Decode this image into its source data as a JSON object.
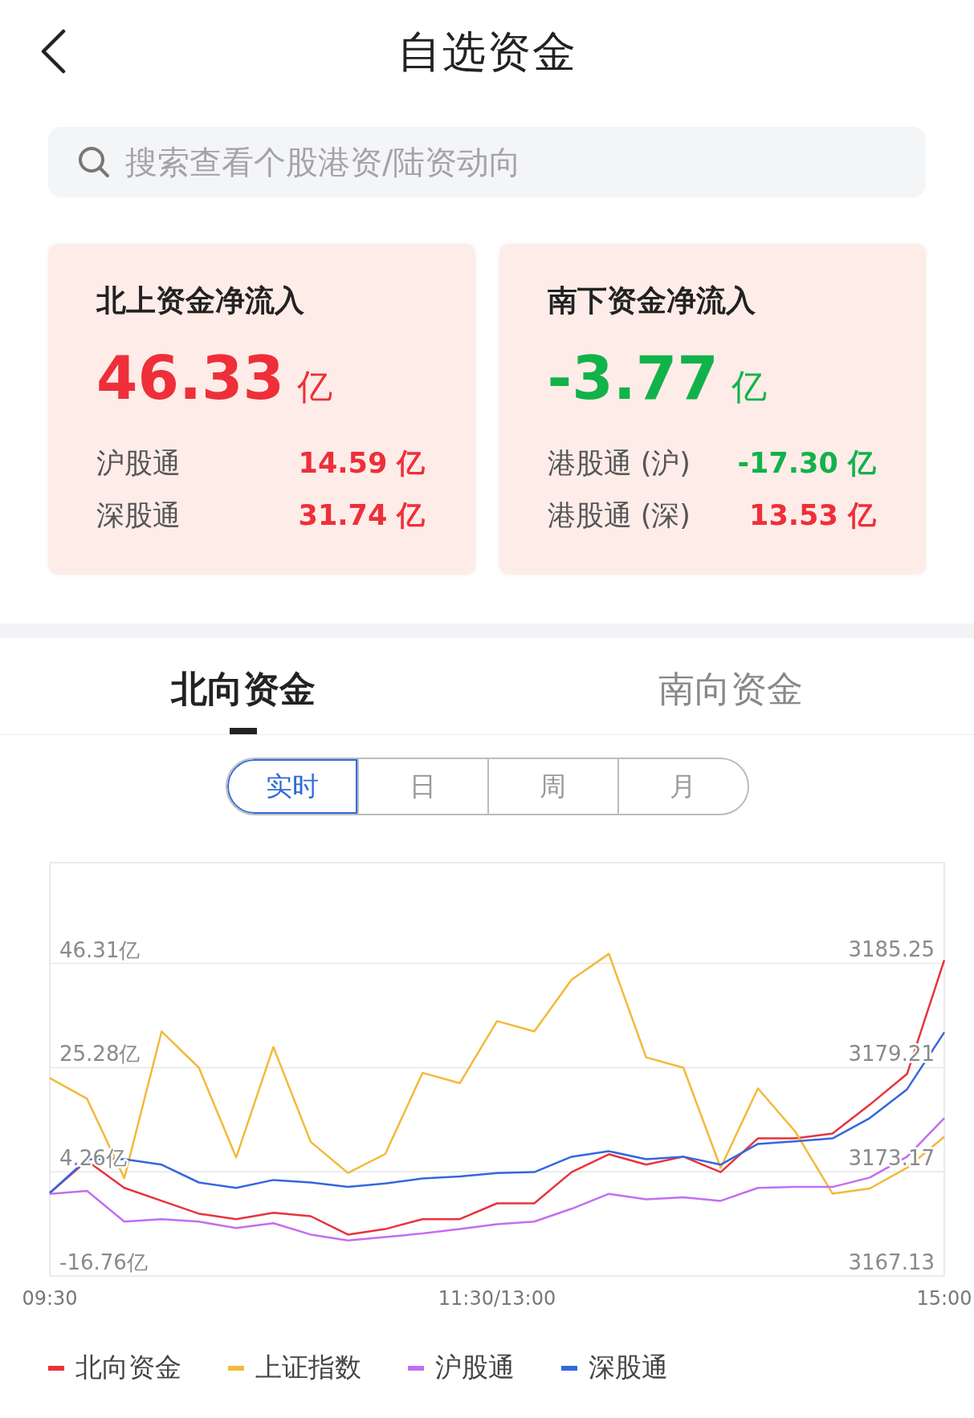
{
  "title": "自选资金",
  "search": {
    "placeholder": "搜索查看个股港资/陆资动向"
  },
  "cards": [
    {
      "title": "北上资金净流入",
      "value": "46.33",
      "unit": "亿",
      "rows": [
        {
          "label": "沪股通",
          "value": "14.59 亿"
        },
        {
          "label": "深股通",
          "value": "31.74 亿"
        }
      ]
    },
    {
      "title": "南下资金净流入",
      "value": "-3.77",
      "unit": "亿",
      "rows": [
        {
          "label": "港股通 (沪)",
          "value": "-17.30 亿"
        },
        {
          "label": "港股通 (深)",
          "value": "13.53 亿"
        }
      ]
    }
  ],
  "tabs": [
    {
      "label": "北向资金",
      "selected": true
    },
    {
      "label": "南向资金",
      "selected": false
    }
  ],
  "periods": [
    {
      "label": "实时",
      "selected": true
    },
    {
      "label": "日",
      "selected": false
    },
    {
      "label": "周",
      "selected": false
    },
    {
      "label": "月",
      "selected": false
    }
  ],
  "chart": {
    "chart_data": {
      "type": "line",
      "grid": true,
      "categories": [
        "09:30",
        null,
        null,
        null,
        null,
        null,
        null,
        null,
        null,
        null,
        null,
        null,
        "11:30/13:00",
        null,
        null,
        null,
        null,
        null,
        null,
        null,
        null,
        null,
        null,
        null,
        "15:00"
      ],
      "ylim": [
        -16.76,
        66.8
      ],
      "yticks": [
        {
          "value": 46.31,
          "label": "46.31亿"
        },
        {
          "value": 25.28,
          "label": "25.28亿"
        },
        {
          "value": 4.26,
          "label": "4.26亿"
        },
        {
          "value": -16.76,
          "label": "-16.76亿"
        }
      ],
      "y2lim": [
        3167.13,
        3191.13
      ],
      "y2ticks": [
        3185.25,
        3179.21,
        3173.17,
        3167.13
      ],
      "series": [
        {
          "name": "北向资金",
          "color": "#e8333c",
          "values": [
            0.0,
            6.5,
            1.0,
            -1.6,
            -4.2,
            -5.3,
            -4.0,
            -4.7,
            -8.4,
            -7.3,
            -5.3,
            -5.3,
            -2.1,
            -2.1,
            4.2,
            7.8,
            5.7,
            7.3,
            4.2,
            11.0,
            11.0,
            12.0,
            17.8,
            24.0,
            47.0
          ]
        },
        {
          "name": "上证指数",
          "color": "#f3b93a",
          "axis": "y2",
          "values": [
            3178.6,
            3177.4,
            3172.8,
            3181.3,
            3179.2,
            3174.0,
            3180.4,
            3174.9,
            3173.1,
            3174.2,
            3178.9,
            3178.3,
            3181.9,
            3181.3,
            3184.3,
            3185.8,
            3179.8,
            3179.2,
            3173.4,
            3178.0,
            3175.5,
            3171.9,
            3172.2,
            3173.4,
            3175.2
          ]
        },
        {
          "name": "沪股通",
          "color": "#c36ef0",
          "values": [
            -0.2,
            0.4,
            -5.8,
            -5.3,
            -5.8,
            -7.1,
            -6.1,
            -8.4,
            -9.6,
            -8.9,
            -8.2,
            -7.3,
            -6.3,
            -5.8,
            -3.2,
            -0.2,
            -1.3,
            -0.9,
            -1.6,
            1.0,
            1.2,
            1.2,
            3.1,
            7.3,
            15.1
          ]
        },
        {
          "name": "深股通",
          "color": "#3566e0",
          "values": [
            0.0,
            6.8,
            6.8,
            5.7,
            2.1,
            1.0,
            2.6,
            2.1,
            1.2,
            1.9,
            2.9,
            3.3,
            4.0,
            4.2,
            7.3,
            8.4,
            6.8,
            7.3,
            5.7,
            9.9,
            10.4,
            11.0,
            15.1,
            20.9,
            32.4
          ]
        }
      ]
    }
  }
}
